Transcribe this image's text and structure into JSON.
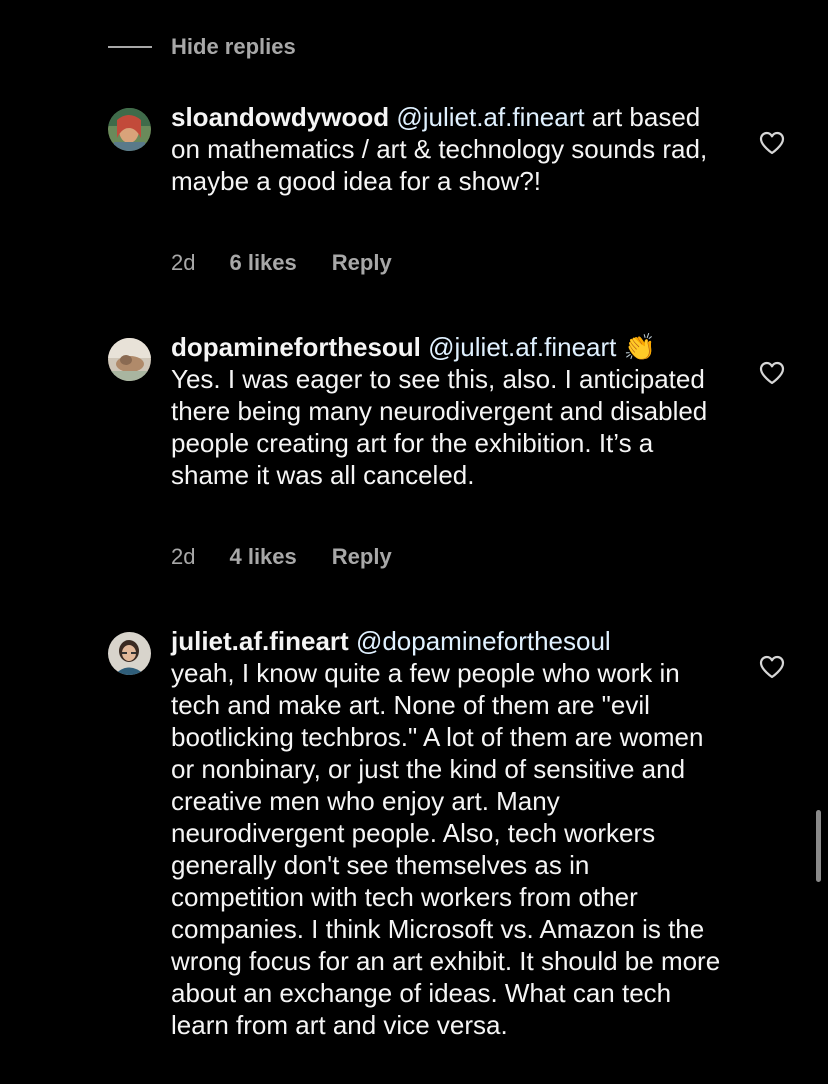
{
  "thread": {
    "hide_replies_label": "Hide replies"
  },
  "comments": [
    {
      "username": "sloandowdywood",
      "mention": "@juliet.af.fineart",
      "text": " art based on mathematics / art & technology sounds rad, maybe a good idea for a show?!",
      "time": "2d",
      "likes": "6 likes",
      "reply_label": "Reply"
    },
    {
      "username": "dopamineforthesoul",
      "mention": "@juliet.af.fineart",
      "emoji": "👏",
      "text": "Yes. I was eager to see this, also. I anticipated there being many neurodivergent and disabled people creating art for the exhibition. It’s a shame it was all canceled.",
      "time": "2d",
      "likes": "4 likes",
      "reply_label": "Reply"
    },
    {
      "username": "juliet.af.fineart",
      "mention": "@dopamineforthesoul",
      "text": "yeah, I know quite a few people who work in tech and make art. None of them are \"evil bootlicking techbros.\" A lot of them are women or nonbinary, or just the kind of sensitive and creative men who enjoy art. Many neurodivergent people. Also, tech workers generally don't see themselves as in competition with tech workers from other companies. I think Microsoft vs. Amazon is the wrong focus for an art exhibit. It should be more about an exchange of ideas. What can tech learn from art and vice versa."
    }
  ],
  "icons": {
    "like": "heart-outline-icon"
  },
  "colors": {
    "background": "#000000",
    "primary_text": "#f5f5f5",
    "secondary_text": "#a8a8a8",
    "mention": "#e0f1ff"
  }
}
